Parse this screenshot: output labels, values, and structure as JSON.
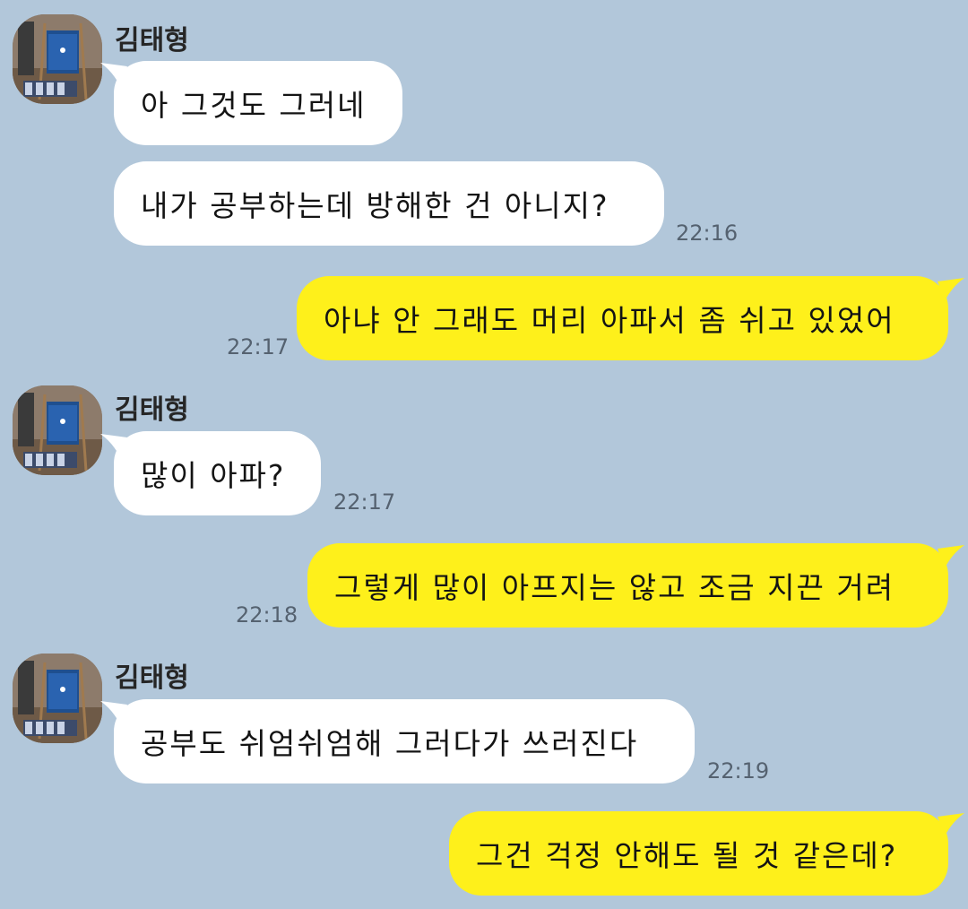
{
  "colors": {
    "background": "#b2c7da",
    "incoming": "#ffffff",
    "outgoing": "#fef01b"
  },
  "contact": {
    "name": "김태형",
    "avatar_icon": "profile-photo-easel"
  },
  "messages": [
    {
      "dir": "in",
      "text": "아 그것도 그러네",
      "time": ""
    },
    {
      "dir": "in",
      "text": "내가 공부하는데 방해한 건 아니지?",
      "time": "22:16"
    },
    {
      "dir": "out",
      "text": "아냐 안 그래도 머리 아파서 좀 쉬고 있었어",
      "time": "22:17"
    },
    {
      "dir": "in",
      "text": "많이 아파?",
      "time": "22:17"
    },
    {
      "dir": "out",
      "text": "그렇게 많이 아프지는 않고 조금 지끈 거려",
      "time": "22:18"
    },
    {
      "dir": "in",
      "text": "공부도 쉬엄쉬엄해 그러다가 쓰러진다",
      "time": "22:19"
    },
    {
      "dir": "out",
      "text": "그건 걱정 안해도 될 것 같은데?",
      "time": ""
    }
  ]
}
